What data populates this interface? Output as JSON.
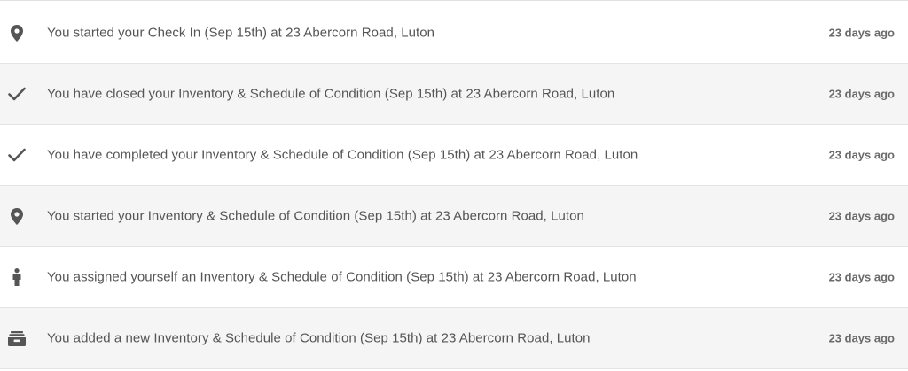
{
  "colors": {
    "icon": "#555555",
    "text": "#555555",
    "time": "#6a6a6a",
    "row_alt_bg": "#f5f5f5",
    "divider": "#e4e4e4"
  },
  "activity": [
    {
      "icon": "map-pin-icon",
      "message": "You started your Check In (Sep 15th) at 23 Abercorn Road, Luton",
      "time": "23 days ago"
    },
    {
      "icon": "checkmark-icon",
      "message": "You have closed your Inventory & Schedule of Condition (Sep 15th) at 23 Abercorn Road, Luton",
      "time": "23 days ago"
    },
    {
      "icon": "checkmark-icon",
      "message": "You have completed your Inventory & Schedule of Condition (Sep 15th) at 23 Abercorn Road, Luton",
      "time": "23 days ago"
    },
    {
      "icon": "map-pin-icon",
      "message": "You started your Inventory & Schedule of Condition (Sep 15th) at 23 Abercorn Road, Luton",
      "time": "23 days ago"
    },
    {
      "icon": "person-icon",
      "message": "You assigned yourself an Inventory & Schedule of Condition (Sep 15th) at 23 Abercorn Road, Luton",
      "time": "23 days ago"
    },
    {
      "icon": "inbox-tray-icon",
      "message": "You added a new Inventory & Schedule of Condition (Sep 15th) at 23 Abercorn Road, Luton",
      "time": "23 days ago"
    }
  ]
}
